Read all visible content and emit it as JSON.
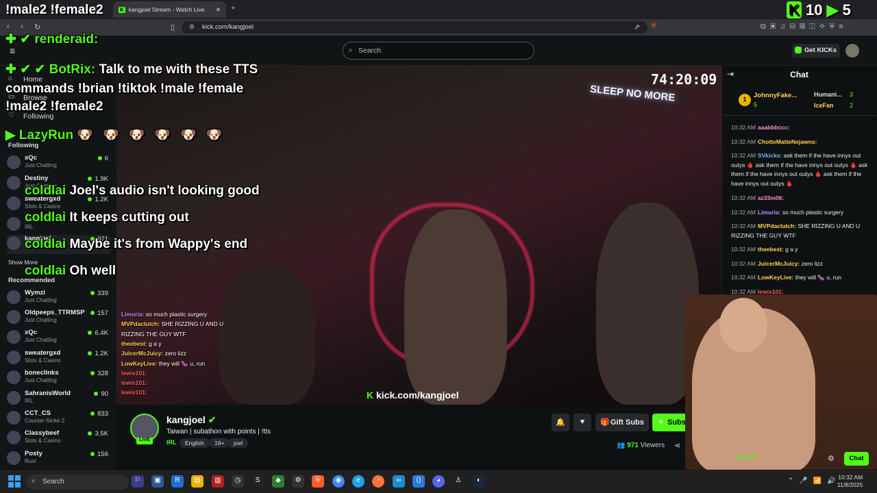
{
  "overlay_top_left": "!male2 !female2",
  "browser": {
    "tab_title": "kangjoel Stream - Watch Live",
    "url": "kick.com/kangjoel",
    "new_tab": "+"
  },
  "overlay_counter": {
    "a": "10",
    "b": "5"
  },
  "header": {
    "search_placeholder": "Search",
    "get_kicks": "Get KICKs"
  },
  "sidebar": {
    "nav": [
      "Home",
      "Browse",
      "Following"
    ],
    "following_title": "Following",
    "following": [
      {
        "name": "xQc",
        "category": "Just Chatting",
        "viewers": "6"
      },
      {
        "name": "Destiny",
        "category": "Just Chatting",
        "viewers": "1.9K"
      },
      {
        "name": "sweatergxd",
        "category": "Slots & Casino",
        "viewers": "1.2K"
      },
      {
        "name": "coldlai",
        "category": "IRL",
        "viewers": ""
      },
      {
        "name": "kangjoel",
        "category": "IRL",
        "viewers": "971"
      }
    ],
    "show_more": "Show More",
    "recommended_title": "Recommended",
    "recommended": [
      {
        "name": "Wymzi",
        "category": "Just Chatting",
        "viewers": "339"
      },
      {
        "name": "Oldpeeps_TTRMSP",
        "category": "Just Chatting",
        "viewers": "157"
      },
      {
        "name": "xQc",
        "category": "Just Chatting",
        "viewers": "6.4K"
      },
      {
        "name": "sweatergxd",
        "category": "Slots & Casino",
        "viewers": "1.2K"
      },
      {
        "name": "boneclinks",
        "category": "Just Chatting",
        "viewers": "328"
      },
      {
        "name": "SahranisWorld",
        "category": "IRL",
        "viewers": "90"
      },
      {
        "name": "CCT_CS",
        "category": "Counter-Strike 2",
        "viewers": "833"
      },
      {
        "name": "Classybeef",
        "category": "Slots & Casino",
        "viewers": "3.5K"
      },
      {
        "name": "Posty",
        "category": "Rust",
        "viewers": "156"
      }
    ]
  },
  "video_overlay": {
    "line1_user": "renderaid:",
    "line2_user": "BotRix:",
    "line2_msg": "Talk to me with these TTS",
    "line3": "commands !brian !tiktok !male !female",
    "line4": "!male2 !female2",
    "line5_user": "LazyRun",
    "chats": [
      {
        "user": "coldlai",
        "msg": "Joel's audio isn't looking good"
      },
      {
        "user": "coldlai",
        "msg": "It keeps cutting out"
      },
      {
        "user": "coldlai",
        "msg": "Maybe it's from Wappy's end"
      },
      {
        "user": "coldlai",
        "msg": "Oh well"
      }
    ],
    "timer": "74:20:09",
    "sign": "SLEEP NO MORE",
    "kick_url": "kick.com/kangjoel"
  },
  "small_chat": [
    {
      "user": "Limuria:",
      "msg": "so much plastic surgery"
    },
    {
      "user": "MVPdaclutch:",
      "msg": "SHE RIZZING U AND U"
    },
    {
      "user": "",
      "msg": "RIZZING THE GUY WTF"
    },
    {
      "user": "theebest:",
      "msg": "g a y"
    },
    {
      "user": "JuicerMcJuicy:",
      "msg": "zero lizz"
    },
    {
      "user": "LowKeyLive:",
      "msg": "they will 🍆 u, run"
    },
    {
      "user": "lewis101:",
      "msg": ""
    },
    {
      "user": "lewis101:",
      "msg": ""
    },
    {
      "user": "lewis101:",
      "msg": ""
    }
  ],
  "chat": {
    "title": "Chat",
    "leaderboard": [
      {
        "rank": "1",
        "name": "JohnnyFake...",
        "count": "5"
      },
      {
        "name": "Humani...",
        "count": "3"
      },
      {
        "name": "IceFan",
        "count": "2"
      }
    ],
    "messages": [
      {
        "time": "10:32 AM",
        "user": "aaabbbccc:",
        "color": "#ff8fd1",
        "msg": ""
      },
      {
        "time": "10:32 AM",
        "user": "ChotteMatteNejawns:",
        "color": "#ffd24d",
        "msg": ""
      },
      {
        "time": "10:32 AM",
        "user": "SVkicks:",
        "color": "#7fb2ff",
        "msg": "ask them if the have innys out outys 🩸 ask them if the have innys out outys 🩸 ask them if the have innys out outys 🩸 ask them if the have innys out outys 🩸"
      },
      {
        "time": "10:32 AM",
        "user": "az33m06:",
        "color": "#ff8fd1",
        "msg": ""
      },
      {
        "time": "10:32 AM",
        "user": "Limuria:",
        "color": "#c58bff",
        "msg": "so much plastic surgery"
      },
      {
        "time": "10:32 AM",
        "user": "MVPdaclutch:",
        "color": "#ffd24d",
        "msg": "SHE RIZZING U AND U RIZZING THE GUY WTF"
      },
      {
        "time": "10:32 AM",
        "user": "theebest:",
        "color": "#ffd24d",
        "msg": "g a y"
      },
      {
        "time": "10:32 AM",
        "user": "JuicerMcJuicy:",
        "color": "#ffd24d",
        "msg": "zero lizz"
      },
      {
        "time": "10:32 AM",
        "user": "LowKeyLive:",
        "color": "#ffd24d",
        "msg": "they will 🍆 u, run"
      },
      {
        "time": "10:32 AM",
        "user": "lewis101:",
        "color": "#ff5b5b",
        "msg": ""
      }
    ]
  },
  "stream": {
    "name": "kangjoel",
    "title": "Taiwan | subathon with points | !tts",
    "live": "LIVE",
    "category": "IRL",
    "tags": [
      "English",
      "18+",
      "joel"
    ],
    "viewers_count": "971",
    "viewers_label": "Viewers",
    "gift_subs": "Gift Subs",
    "subscribe": "Subscribe",
    "chat_button": "Chat",
    "cam_counter": "30,970"
  },
  "taskbar": {
    "search": "Search",
    "time": "10:32 AM",
    "date": "11/8/2025"
  },
  "colors": {
    "kick_green": "#53fc18",
    "bg": "#0e1112"
  }
}
